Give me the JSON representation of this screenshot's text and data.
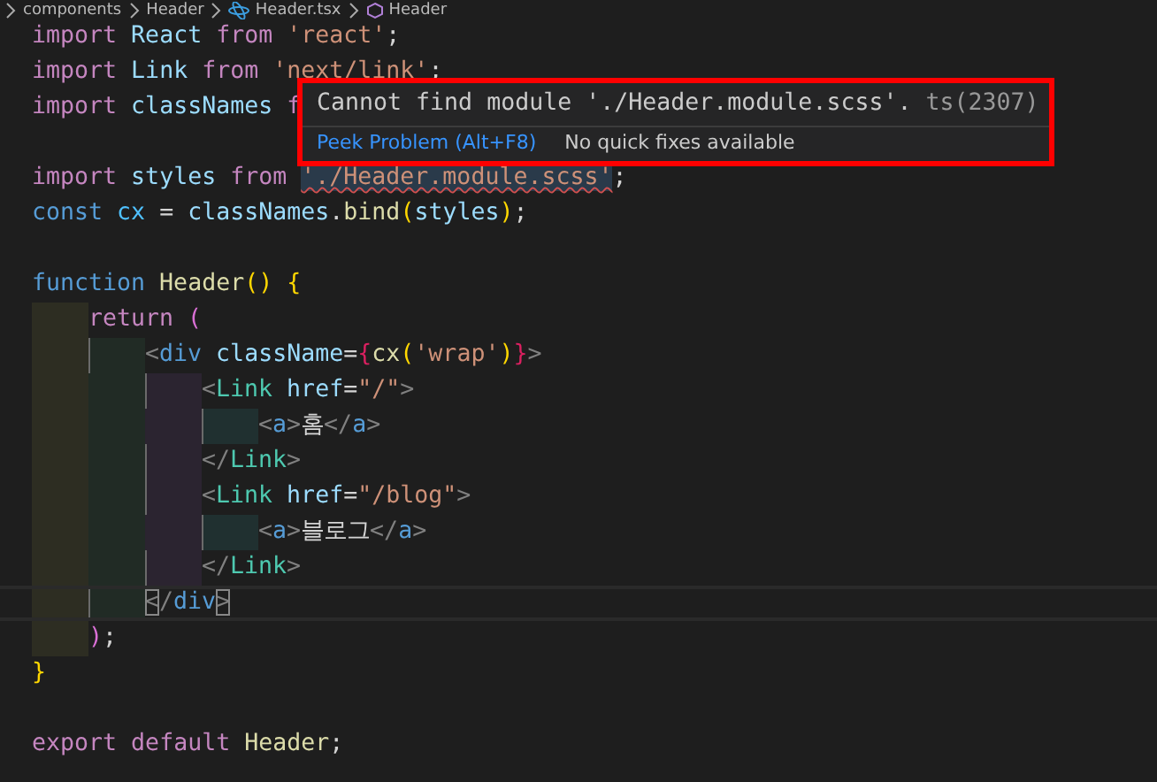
{
  "breadcrumb": [
    {
      "label": "components",
      "kind": "folder"
    },
    {
      "label": "Header",
      "kind": "folder"
    },
    {
      "label": "Header.tsx",
      "kind": "file"
    },
    {
      "label": "Header",
      "kind": "symbol"
    }
  ],
  "code": [
    {
      "current": false,
      "tokens": [
        {
          "text": "import",
          "kind": "kw"
        },
        {
          "text": " React ",
          "kind": "var"
        },
        {
          "text": "from",
          "kind": "kw"
        },
        {
          "text": " 'react'",
          "kind": "str"
        },
        {
          "text": ";",
          "kind": "punc"
        }
      ]
    },
    {
      "current": false,
      "tokens": [
        {
          "text": "import",
          "kind": "kw"
        },
        {
          "text": " Link ",
          "kind": "var"
        },
        {
          "text": "from",
          "kind": "kw"
        },
        {
          "text": " 'next/link'",
          "kind": "str"
        },
        {
          "text": ";",
          "kind": "punc"
        }
      ]
    },
    {
      "current": false,
      "tokens": [
        {
          "text": "import",
          "kind": "kw"
        },
        {
          "text": " classNames ",
          "kind": "var"
        },
        {
          "text": "f",
          "kind": "kw"
        }
      ]
    },
    {
      "current": false
    },
    {
      "current": false,
      "tokens": [
        {
          "text": "import",
          "kind": "kw"
        },
        {
          "text": " styles ",
          "kind": "var"
        },
        {
          "text": "from ",
          "kind": "kw"
        },
        {
          "text": "'./Header.module.scss'",
          "kind": "err"
        },
        {
          "text": ";",
          "kind": "punc"
        }
      ]
    },
    {
      "current": false,
      "tokens": [
        {
          "text": "const",
          "kind": "decl"
        },
        {
          "text": " cx ",
          "kind": "const"
        },
        {
          "text": "= ",
          "kind": "punc"
        },
        {
          "text": "classNames",
          "kind": "var"
        },
        {
          "text": ".",
          "kind": "punc"
        },
        {
          "text": "bind",
          "kind": "fn"
        },
        {
          "text": "(",
          "kind": "br1"
        },
        {
          "text": "styles",
          "kind": "var"
        },
        {
          "text": ")",
          "kind": "br1"
        },
        {
          "text": ";",
          "kind": "punc"
        }
      ]
    },
    {
      "current": false
    },
    {
      "current": false,
      "tokens": [
        {
          "text": "function",
          "kind": "decl"
        },
        {
          "text": " Header",
          "kind": "fn"
        },
        {
          "text": "() {",
          "kind": "br1"
        }
      ],
      "children": [
        {
          "current": false,
          "tokens": [
            {
              "text": "return",
              "kind": "kw"
            },
            {
              "text": " (",
              "kind": "br2"
            }
          ],
          "children": [
            {
              "current": false,
              "tokens": [
                {
                  "text": "<",
                  "kind": "angle"
                },
                {
                  "text": "div",
                  "kind": "htag"
                },
                {
                  "text": " className",
                  "kind": "attr"
                },
                {
                  "text": "=",
                  "kind": "punc"
                },
                {
                  "text": "{",
                  "kind": "br3"
                },
                {
                  "text": "cx",
                  "kind": "fn"
                },
                {
                  "text": "(",
                  "kind": "br1"
                },
                {
                  "text": "'wrap'",
                  "kind": "str"
                },
                {
                  "text": ")",
                  "kind": "br1"
                },
                {
                  "text": "}",
                  "kind": "br3"
                },
                {
                  "text": ">",
                  "kind": "angle"
                }
              ],
              "children": [
                {
                  "current": false,
                  "tokens": [
                    {
                      "text": "<",
                      "kind": "angle"
                    },
                    {
                      "text": "Link",
                      "kind": "tag"
                    },
                    {
                      "text": " href",
                      "kind": "attr"
                    },
                    {
                      "text": "=",
                      "kind": "punc"
                    },
                    {
                      "text": "\"/\"",
                      "kind": "str"
                    },
                    {
                      "text": ">",
                      "kind": "angle"
                    }
                  ],
                  "children": [
                    {
                      "current": false,
                      "tokens": [
                        {
                          "text": "<",
                          "kind": "angle"
                        },
                        {
                          "text": "a",
                          "kind": "htag"
                        },
                        {
                          "text": ">",
                          "kind": "angle"
                        },
                        {
                          "text": "홈",
                          "kind": "text"
                        },
                        {
                          "text": "</",
                          "kind": "angle"
                        },
                        {
                          "text": "a",
                          "kind": "htag"
                        },
                        {
                          "text": ">",
                          "kind": "angle"
                        }
                      ]
                    }
                  ]
                },
                {
                  "current": false,
                  "tokens": [
                    {
                      "text": "</",
                      "kind": "angle"
                    },
                    {
                      "text": "Link",
                      "kind": "tag"
                    },
                    {
                      "text": ">",
                      "kind": "angle"
                    }
                  ]
                },
                {
                  "current": false,
                  "tokens": [
                    {
                      "text": "<",
                      "kind": "angle"
                    },
                    {
                      "text": "Link",
                      "kind": "tag"
                    },
                    {
                      "text": " href",
                      "kind": "attr"
                    },
                    {
                      "text": "=",
                      "kind": "punc"
                    },
                    {
                      "text": "\"/blog\"",
                      "kind": "str"
                    },
                    {
                      "text": ">",
                      "kind": "angle"
                    }
                  ],
                  "children": [
                    {
                      "current": false,
                      "tokens": [
                        {
                          "text": "<",
                          "kind": "angle"
                        },
                        {
                          "text": "a",
                          "kind": "htag"
                        },
                        {
                          "text": ">",
                          "kind": "angle"
                        },
                        {
                          "text": "블로그",
                          "kind": "text"
                        },
                        {
                          "text": "</",
                          "kind": "angle"
                        },
                        {
                          "text": "a",
                          "kind": "htag"
                        },
                        {
                          "text": ">",
                          "kind": "angle"
                        }
                      ]
                    }
                  ]
                },
                {
                  "current": false,
                  "tokens": [
                    {
                      "text": "</",
                      "kind": "angle"
                    },
                    {
                      "text": "Link",
                      "kind": "tag"
                    },
                    {
                      "text": ">",
                      "kind": "angle"
                    }
                  ]
                }
              ]
            },
            {
              "current": true,
              "tokens": [
                {
                  "text": "<",
                  "kind": "match"
                },
                {
                  "text": "/",
                  "kind": "angle"
                },
                {
                  "text": "div",
                  "kind": "htag"
                },
                {
                  "text": ">",
                  "kind": "match"
                }
              ]
            }
          ]
        },
        {
          "current": false,
          "tokens": [
            {
              "text": ")",
              "kind": "br2"
            },
            {
              "text": ";",
              "kind": "punc"
            }
          ]
        }
      ]
    },
    {
      "current": false,
      "tokens": [
        {
          "text": "}",
          "kind": "br1"
        }
      ]
    },
    {
      "current": false
    },
    {
      "current": false,
      "tokens": [
        {
          "text": "export",
          "kind": "kw"
        },
        {
          "text": " default",
          "kind": "kw"
        },
        {
          "text": " Header",
          "kind": "fn"
        },
        {
          "text": ";",
          "kind": "punc"
        }
      ]
    }
  ],
  "hover": {
    "message": "Cannot find module './Header.module.scss'.",
    "code": "ts(2307)",
    "action": "Peek Problem (Alt+F8)",
    "note": "No quick fixes available"
  }
}
